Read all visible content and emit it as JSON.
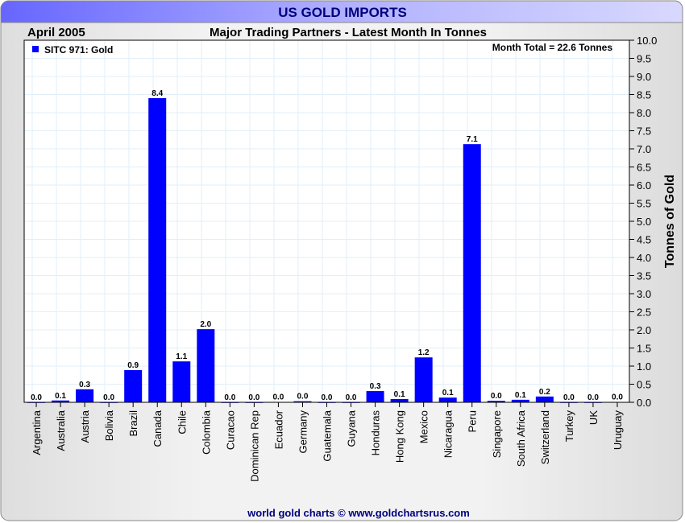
{
  "chart_data": {
    "type": "bar",
    "title": "US GOLD IMPORTS",
    "period": "April 2005",
    "subtitle": "Major Trading Partners - Latest Month In Tonnes",
    "legend": "SITC 971: Gold",
    "legend_position": "top-left",
    "annotation": "Month Total = 22.6 Tonnes",
    "ylabel": "Tonnes of Gold",
    "xlabel": "",
    "ylim": [
      0,
      10
    ],
    "yticks": [
      "0.0",
      "0.5",
      "1.0",
      "1.5",
      "2.0",
      "2.5",
      "3.0",
      "3.5",
      "4.0",
      "4.5",
      "5.0",
      "5.5",
      "6.0",
      "6.5",
      "7.0",
      "7.5",
      "8.0",
      "8.5",
      "9.0",
      "9.5",
      "10.0"
    ],
    "grid": true,
    "bar_color": "#0000ff",
    "categories": [
      "Argentina",
      "Australia",
      "Austria",
      "Bolivia",
      "Brazil",
      "Canada",
      "Chile",
      "Colombia",
      "Curacao",
      "Dominican Rep",
      "Ecuador",
      "Germany",
      "Guatemala",
      "Guyana",
      "Honduras",
      "Hong Kong",
      "Mexico",
      "Nicaragua",
      "Peru",
      "Singapore",
      "South Africa",
      "Switzerland",
      "Turkey",
      "UK",
      "Uruguay"
    ],
    "values": [
      0.0,
      0.05,
      0.36,
      0.0,
      0.89,
      8.4,
      1.13,
      2.02,
      0.0,
      0.0,
      0.01,
      0.03,
      0.0,
      0.0,
      0.31,
      0.09,
      1.24,
      0.13,
      7.13,
      0.04,
      0.07,
      0.16,
      0.0,
      0.0,
      0.01
    ],
    "labels": [
      "0.0",
      "0.1",
      "0.3",
      "0.0",
      "0.9",
      "8.4",
      "1.1",
      "2.0",
      "0.0",
      "0.0",
      "0.0",
      "0.0",
      "0.0",
      "0.0",
      "0.3",
      "0.1",
      "1.2",
      "0.1",
      "7.1",
      "0.0",
      "0.1",
      "0.2",
      "0.0",
      "0.0",
      "0.0"
    ],
    "footer": "world gold charts © www.goldchartsrus.com"
  }
}
